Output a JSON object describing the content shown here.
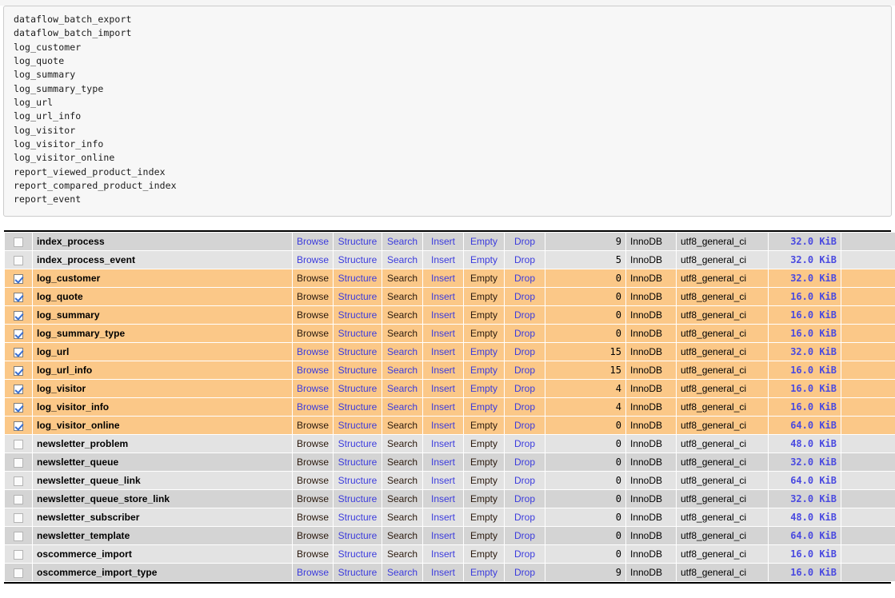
{
  "code_block": {
    "lines": [
      "dataflow_batch_export",
      "dataflow_batch_import",
      "log_customer",
      "log_quote",
      "log_summary",
      "log_summary_type",
      "log_url",
      "log_url_info",
      "log_visitor",
      "log_visitor_info",
      "log_visitor_online",
      "report_viewed_product_index",
      "report_compared_product_index",
      "report_event"
    ]
  },
  "table": {
    "action_labels": {
      "browse": "Browse",
      "structure": "Structure",
      "search": "Search",
      "insert": "Insert",
      "empty": "Empty",
      "drop": "Drop"
    },
    "colors": {
      "link": "#3b3bdd",
      "visited_link": "#2b1a0e",
      "selected_row": "#fbc888",
      "row_odd": "#d4d4d4",
      "row_even": "#e3e3e3",
      "size_text": "#4a4ae0"
    },
    "overhead_placeholder": "-",
    "rows": [
      {
        "name": "index_process",
        "checked": false,
        "selected": false,
        "stripe": "odd",
        "rows_count": "9",
        "engine": "InnoDB",
        "collation": "utf8_general_ci",
        "size": "32.0 KiB",
        "overhead": "-",
        "link_states": [
          "blue",
          "blue",
          "blue",
          "blue",
          "blue",
          "blue"
        ]
      },
      {
        "name": "index_process_event",
        "checked": false,
        "selected": false,
        "stripe": "even",
        "rows_count": "5",
        "engine": "InnoDB",
        "collation": "utf8_general_ci",
        "size": "32.0 KiB",
        "overhead": "-",
        "link_states": [
          "blue",
          "blue",
          "blue",
          "blue",
          "blue",
          "blue"
        ]
      },
      {
        "name": "log_customer",
        "checked": true,
        "selected": true,
        "stripe": "odd",
        "rows_count": "0",
        "engine": "InnoDB",
        "collation": "utf8_general_ci",
        "size": "32.0 KiB",
        "overhead": "-",
        "link_states": [
          "visited",
          "blue",
          "visited",
          "blue",
          "visited",
          "blue"
        ]
      },
      {
        "name": "log_quote",
        "checked": true,
        "selected": true,
        "stripe": "even",
        "rows_count": "0",
        "engine": "InnoDB",
        "collation": "utf8_general_ci",
        "size": "16.0 KiB",
        "overhead": "-",
        "link_states": [
          "visited",
          "blue",
          "visited",
          "blue",
          "visited",
          "blue"
        ]
      },
      {
        "name": "log_summary",
        "checked": true,
        "selected": true,
        "stripe": "odd",
        "rows_count": "0",
        "engine": "InnoDB",
        "collation": "utf8_general_ci",
        "size": "16.0 KiB",
        "overhead": "-",
        "link_states": [
          "visited",
          "blue",
          "visited",
          "blue",
          "visited",
          "blue"
        ]
      },
      {
        "name": "log_summary_type",
        "checked": true,
        "selected": true,
        "stripe": "even",
        "rows_count": "0",
        "engine": "InnoDB",
        "collation": "utf8_general_ci",
        "size": "16.0 KiB",
        "overhead": "-",
        "link_states": [
          "visited",
          "blue",
          "visited",
          "blue",
          "visited",
          "blue"
        ]
      },
      {
        "name": "log_url",
        "checked": true,
        "selected": true,
        "stripe": "odd",
        "rows_count": "15",
        "engine": "InnoDB",
        "collation": "utf8_general_ci",
        "size": "32.0 KiB",
        "overhead": "-",
        "link_states": [
          "blue",
          "blue",
          "blue",
          "blue",
          "blue",
          "blue"
        ]
      },
      {
        "name": "log_url_info",
        "checked": true,
        "selected": true,
        "stripe": "even",
        "rows_count": "15",
        "engine": "InnoDB",
        "collation": "utf8_general_ci",
        "size": "16.0 KiB",
        "overhead": "-",
        "link_states": [
          "blue",
          "blue",
          "blue",
          "blue",
          "blue",
          "blue"
        ]
      },
      {
        "name": "log_visitor",
        "checked": true,
        "selected": true,
        "stripe": "odd",
        "rows_count": "4",
        "engine": "InnoDB",
        "collation": "utf8_general_ci",
        "size": "16.0 KiB",
        "overhead": "-",
        "link_states": [
          "blue",
          "blue",
          "blue",
          "blue",
          "blue",
          "blue"
        ]
      },
      {
        "name": "log_visitor_info",
        "checked": true,
        "selected": true,
        "stripe": "even",
        "rows_count": "4",
        "engine": "InnoDB",
        "collation": "utf8_general_ci",
        "size": "16.0 KiB",
        "overhead": "-",
        "link_states": [
          "blue",
          "blue",
          "blue",
          "blue",
          "blue",
          "blue"
        ]
      },
      {
        "name": "log_visitor_online",
        "checked": true,
        "selected": true,
        "stripe": "odd",
        "rows_count": "0",
        "engine": "InnoDB",
        "collation": "utf8_general_ci",
        "size": "64.0 KiB",
        "overhead": "-",
        "link_states": [
          "visited",
          "blue",
          "visited",
          "blue",
          "visited",
          "blue"
        ]
      },
      {
        "name": "newsletter_problem",
        "checked": false,
        "selected": false,
        "stripe": "even",
        "rows_count": "0",
        "engine": "InnoDB",
        "collation": "utf8_general_ci",
        "size": "48.0 KiB",
        "overhead": "-",
        "link_states": [
          "visited",
          "blue",
          "visited",
          "blue",
          "visited",
          "blue"
        ]
      },
      {
        "name": "newsletter_queue",
        "checked": false,
        "selected": false,
        "stripe": "odd",
        "rows_count": "0",
        "engine": "InnoDB",
        "collation": "utf8_general_ci",
        "size": "32.0 KiB",
        "overhead": "-",
        "link_states": [
          "visited",
          "blue",
          "visited",
          "blue",
          "visited",
          "blue"
        ]
      },
      {
        "name": "newsletter_queue_link",
        "checked": false,
        "selected": false,
        "stripe": "even",
        "rows_count": "0",
        "engine": "InnoDB",
        "collation": "utf8_general_ci",
        "size": "64.0 KiB",
        "overhead": "-",
        "link_states": [
          "visited",
          "blue",
          "visited",
          "blue",
          "visited",
          "blue"
        ]
      },
      {
        "name": "newsletter_queue_store_link",
        "checked": false,
        "selected": false,
        "stripe": "odd",
        "rows_count": "0",
        "engine": "InnoDB",
        "collation": "utf8_general_ci",
        "size": "32.0 KiB",
        "overhead": "-",
        "link_states": [
          "visited",
          "blue",
          "visited",
          "blue",
          "visited",
          "blue"
        ]
      },
      {
        "name": "newsletter_subscriber",
        "checked": false,
        "selected": false,
        "stripe": "even",
        "rows_count": "0",
        "engine": "InnoDB",
        "collation": "utf8_general_ci",
        "size": "48.0 KiB",
        "overhead": "-",
        "link_states": [
          "visited",
          "blue",
          "visited",
          "blue",
          "visited",
          "blue"
        ]
      },
      {
        "name": "newsletter_template",
        "checked": false,
        "selected": false,
        "stripe": "odd",
        "rows_count": "0",
        "engine": "InnoDB",
        "collation": "utf8_general_ci",
        "size": "64.0 KiB",
        "overhead": "-",
        "link_states": [
          "visited",
          "blue",
          "visited",
          "blue",
          "visited",
          "blue"
        ]
      },
      {
        "name": "oscommerce_import",
        "checked": false,
        "selected": false,
        "stripe": "even",
        "rows_count": "0",
        "engine": "InnoDB",
        "collation": "utf8_general_ci",
        "size": "16.0 KiB",
        "overhead": "-",
        "link_states": [
          "visited",
          "blue",
          "visited",
          "blue",
          "visited",
          "blue"
        ]
      },
      {
        "name": "oscommerce_import_type",
        "checked": false,
        "selected": false,
        "stripe": "odd",
        "rows_count": "9",
        "engine": "InnoDB",
        "collation": "utf8_general_ci",
        "size": "16.0 KiB",
        "overhead": "-",
        "link_states": [
          "blue",
          "blue",
          "blue",
          "blue",
          "blue",
          "blue"
        ]
      }
    ]
  }
}
